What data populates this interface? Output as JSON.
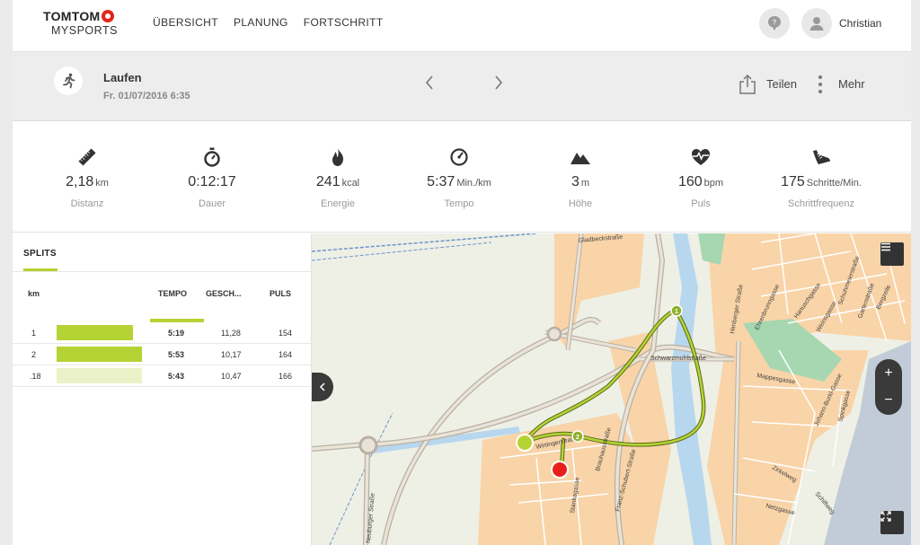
{
  "logo": {
    "brand": "TOMTOM",
    "sub": "MYSPORTS"
  },
  "nav": {
    "items": [
      "ÜBERSICHT",
      "PLANUNG",
      "FORTSCHRITT"
    ]
  },
  "user": {
    "name": "Christian"
  },
  "activity": {
    "title": "Laufen",
    "date": "Fr. 01/07/2016 6:35",
    "share_label": "Teilen",
    "more_label": "Mehr"
  },
  "stats": [
    {
      "value": "2,18",
      "unit": "km",
      "label": "Distanz",
      "icon": "ruler-icon"
    },
    {
      "value": "0:12:17",
      "unit": "",
      "label": "Dauer",
      "icon": "stopwatch-icon"
    },
    {
      "value": "241",
      "unit": "kcal",
      "label": "Energie",
      "icon": "flame-icon"
    },
    {
      "value": "5:37",
      "unit": "Min./km",
      "label": "Tempo",
      "icon": "speedometer-icon"
    },
    {
      "value": "3",
      "unit": "m",
      "label": "Höhe",
      "icon": "mountain-icon"
    },
    {
      "value": "160",
      "unit": "bpm",
      "label": "Puls",
      "icon": "heart-rate-icon"
    },
    {
      "value": "175",
      "unit": "Schritte/Min.",
      "label": "Schrittfrequenz",
      "icon": "shoe-icon"
    }
  ],
  "splits": {
    "title": "SPLITS",
    "headers": {
      "km": "km",
      "tempo": "TEMPO",
      "speed": "GESCH...",
      "pulse": "PULS"
    },
    "rows": [
      {
        "km": "1",
        "tempo": "5:19",
        "speed": "11,28",
        "pulse": "154",
        "bar_fraction": 0.82,
        "bar_color": "#b5d334"
      },
      {
        "km": "2",
        "tempo": "5:53",
        "speed": "10,17",
        "pulse": "164",
        "bar_fraction": 0.91,
        "bar_color": "#b5d334"
      },
      {
        "km": ".18",
        "tempo": "5:43",
        "speed": "10,47",
        "pulse": "166",
        "bar_fraction": 0.91,
        "bar_color": "#ecf2c8"
      }
    ]
  },
  "map": {
    "streets": [
      "Gladbeckstraße",
      "Schwarzmuhlstraße",
      "Wirtingerstraße",
      "Brauhausstraße",
      "Franz-Schubert-Straße",
      "Stankagasse",
      "Neuburger Straße",
      "Himberger Straße",
      "Ehrenbrunngasse",
      "Hanuschgasse",
      "Weinsgasse",
      "Schuhmeierstraße",
      "Gartenstraße",
      "Bergzeile",
      "Mappesgasse",
      "Johann-Burkl-Gasse",
      "Spinkgasse",
      "Zirkelweg",
      "Netzgasse",
      "Schilfweg"
    ],
    "markers": {
      "split1": "1",
      "split2": "2"
    },
    "zoom_in": "+",
    "zoom_out": "−"
  },
  "colors": {
    "accent": "#b5d334",
    "route": "#9fbf2a",
    "start": "#b5d334",
    "end": "#e8201a",
    "land": "#f9d4a8",
    "water": "#b7d7ee"
  }
}
